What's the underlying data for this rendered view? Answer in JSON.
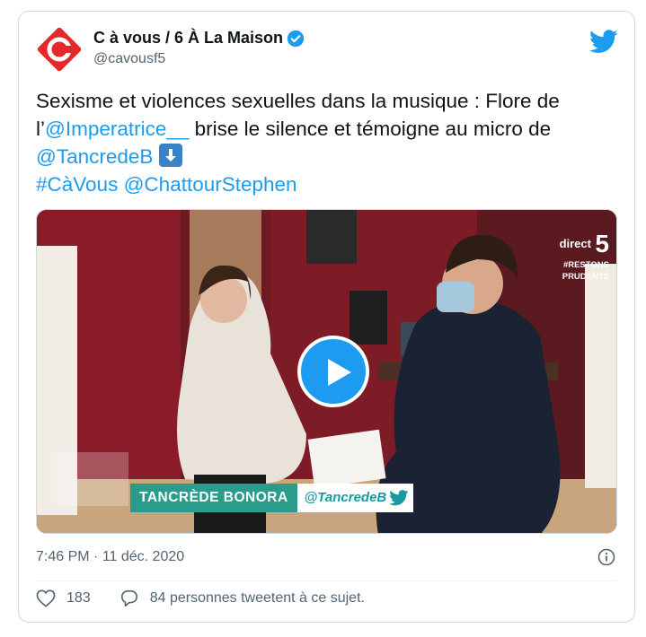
{
  "account": {
    "name": "C à vous / 6 À La Maison",
    "handle": "@cavousf5",
    "verified": true
  },
  "tweet": {
    "line1": "Sexisme et violences sexuelles dans la musique : Flore de",
    "line2_prefix": "l’",
    "mention1": "@Imperatrice__",
    "line2_suffix": " brise le silence et témoigne au micro de",
    "mention2": "@TancredeB",
    "hashtag1": "#CàVous",
    "mention3": "@ChattourStephen"
  },
  "video": {
    "lower_third_name": "TANCRÈDE BONORA",
    "lower_third_handle": "@TancredeB",
    "channel_direct": "direct",
    "channel_number": "5",
    "channel_tag_line1": "#RESTONS",
    "channel_tag_line2": "PRUDENTS"
  },
  "meta": {
    "time": "7:46 PM",
    "separator": " · ",
    "date": "11 déc. 2020"
  },
  "actions": {
    "likes": "183",
    "comments_text": "84 personnes tweetent à ce sujet."
  },
  "colors": {
    "accent": "#1d9bf0",
    "brand_red": "#e5282b",
    "lower_third_teal": "#2a9c8c"
  }
}
